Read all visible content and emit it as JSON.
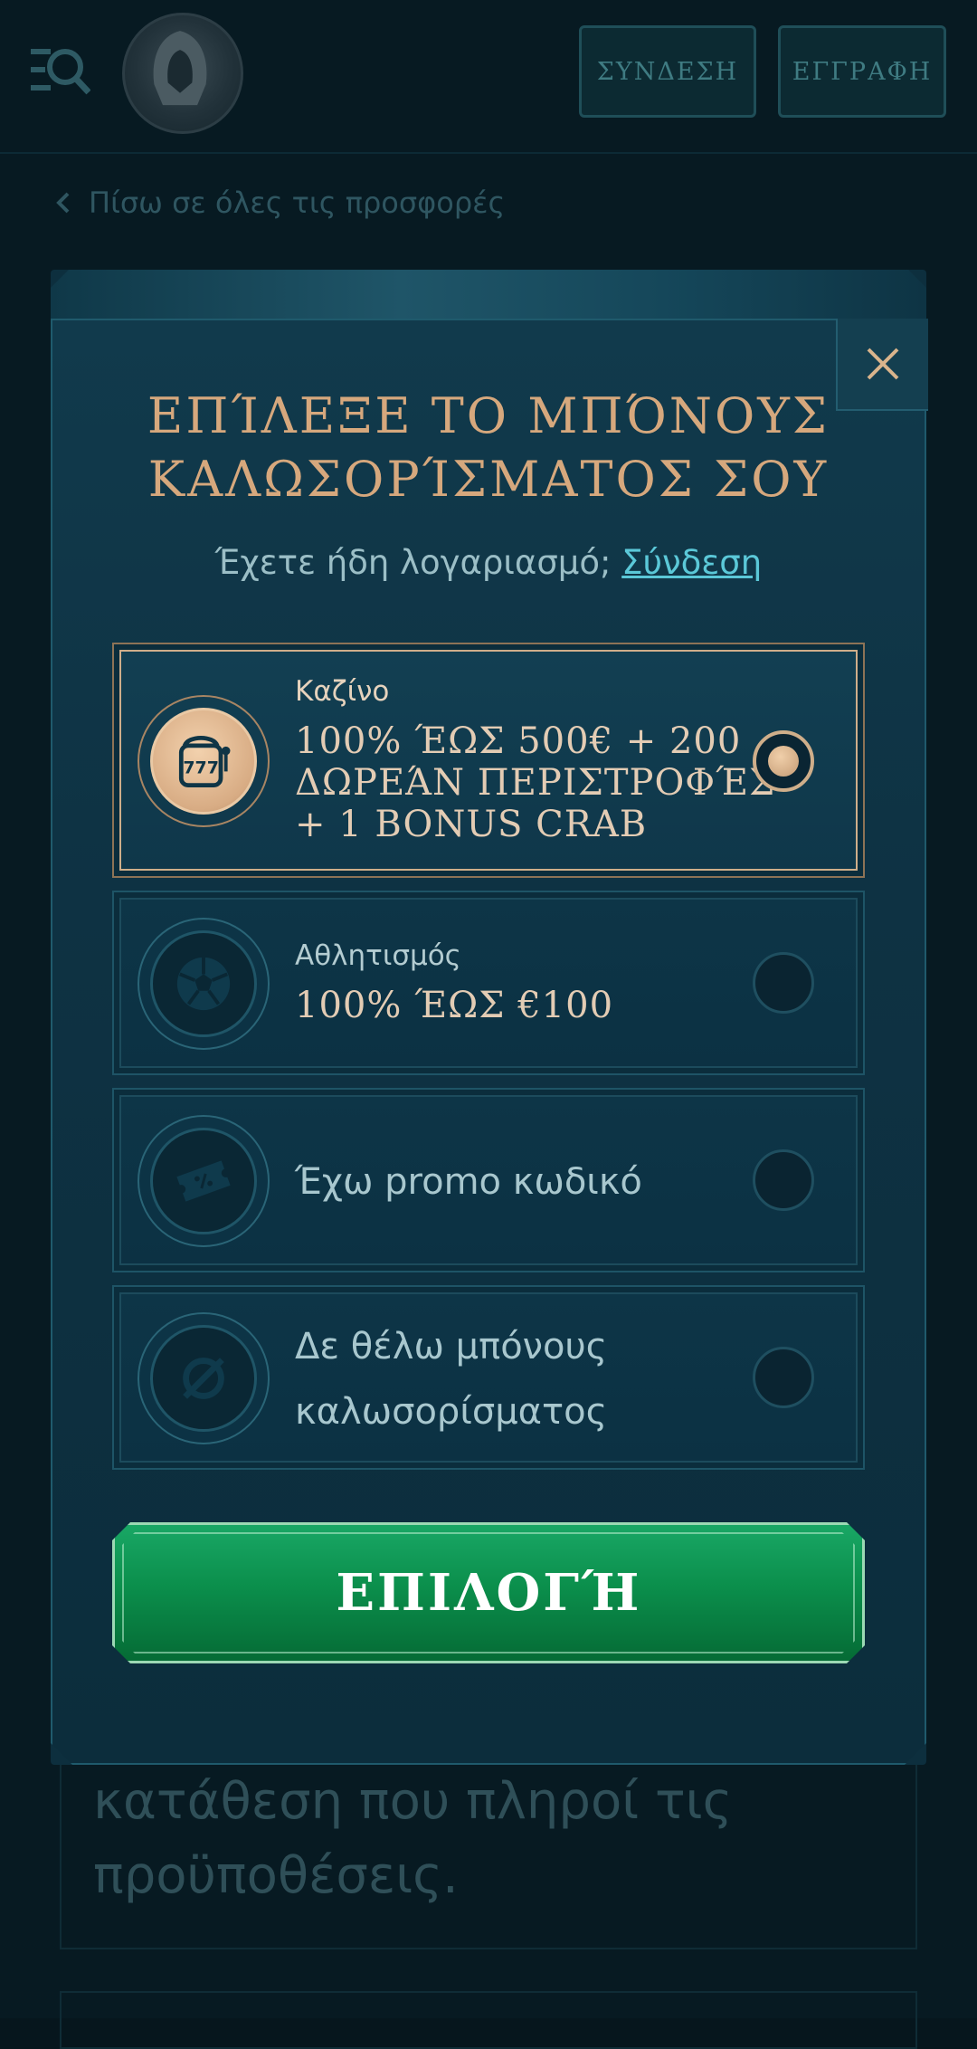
{
  "header": {
    "login_label": "ΣΥΝΔΕΣΗ",
    "register_label": "ΕΓΓΡΑΦΗ",
    "menu_icon": "menu-search-icon",
    "logo_icon": "hooded-figure-logo"
  },
  "back_link": {
    "label": "Πίσω σε όλες τις προσφορές"
  },
  "background_text": {
    "line1": "κατάθεση που πληροί τις",
    "line2": "προϋποθέσεις."
  },
  "modal": {
    "title_line1": "ΕΠΊΛΕΞΕ ΤΟ ΜΠΌΝΟΥΣ",
    "title_line2": "ΚΑΛΩΣΟΡΊΣΜΑΤΟΣ ΣΟΥ",
    "account_prompt": "Έχετε ήδη λογαριασμό;",
    "login_link": "Σύνδεση",
    "options": [
      {
        "category": "Καζίνο",
        "offer_line1": "100% ΈΩΣ 500€ + 200",
        "offer_line2": "ΔΩΡΕΆΝ ΠΕΡΙΣΤΡΟΦΈΣ",
        "offer_line3": "+ 1 BONUS CRAB",
        "icon": "slot-machine-icon",
        "selected": true
      },
      {
        "category": "Αθλητισμός",
        "offer_line1": "100% ΈΩΣ €100",
        "icon": "soccer-ball-icon",
        "selected": false
      },
      {
        "label": "Έχω promo κωδικό",
        "icon": "ticket-icon",
        "selected": false
      },
      {
        "label_line1": "Δε θέλω μπόνους",
        "label_line2": "καλωσορίσματος",
        "icon": "no-symbol-icon",
        "selected": false
      }
    ],
    "cta_label": "ΕΠΙΛΟΓΉ"
  },
  "colors": {
    "background": "#06161d",
    "modal": "#0e3243",
    "gold_accent": "#d6a87d",
    "link": "#5bc8d8",
    "cta_green": "#0b8f4c"
  }
}
